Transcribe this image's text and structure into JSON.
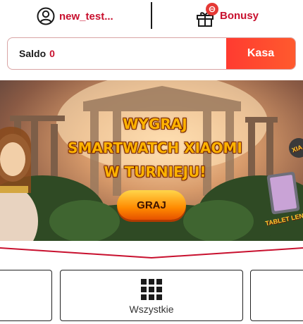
{
  "header": {
    "username": "new_test...",
    "user_icon": "user-circle-icon",
    "bonus_label": "Bonusy",
    "bonus_icon": "gift-icon",
    "bonus_badge_icon": "coin-icon"
  },
  "balance": {
    "label": "Saldo",
    "value": "0",
    "cashier_label": "Kasa"
  },
  "promo": {
    "line1": "WYGRAJ",
    "line2": "SMARTWATCH XIAOMI",
    "line3": "W TURNIEJU!",
    "cta_label": "GRAJ",
    "side_label_top": "XIA",
    "side_label_bottom": "TABLET LENO"
  },
  "categories": [
    {
      "label": ""
    },
    {
      "label": "Wszystkie",
      "icon": "grid-icon"
    },
    {
      "label": ""
    }
  ],
  "colors": {
    "brand_red": "#c8102e",
    "cashier_button": "#ff3b30",
    "promo_text": "#ffb300"
  }
}
